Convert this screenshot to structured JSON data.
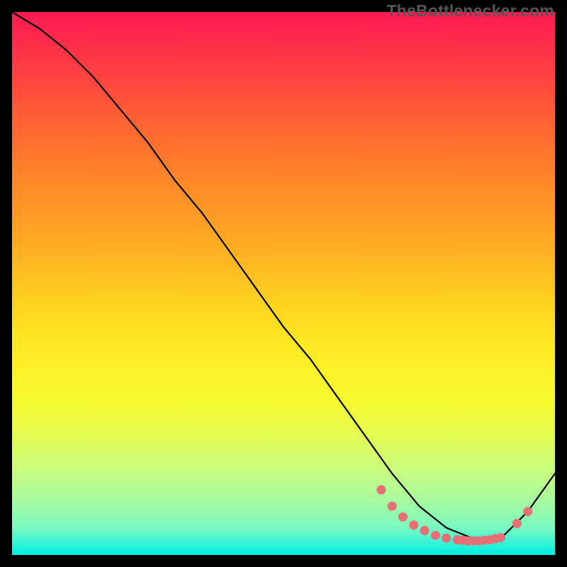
{
  "attribution": "TheBottlenecker.com",
  "chart_data": {
    "type": "line",
    "title": "",
    "xlabel": "",
    "ylabel": "",
    "xlim": [
      0,
      100
    ],
    "ylim": [
      0,
      100
    ],
    "series": [
      {
        "name": "curve",
        "x": [
          0,
          5,
          10,
          15,
          20,
          25,
          30,
          35,
          40,
          45,
          50,
          55,
          60,
          65,
          70,
          75,
          80,
          85,
          90,
          95,
          100
        ],
        "values": [
          100,
          97,
          93,
          88,
          82,
          76,
          69,
          63,
          56,
          49,
          42,
          36,
          29,
          22,
          15,
          9,
          5,
          3,
          3,
          8,
          15
        ]
      }
    ],
    "markers": {
      "name": "highlight-points",
      "color": "#e77077",
      "x": [
        68,
        70,
        72,
        74,
        76,
        78,
        80,
        82,
        83,
        84,
        85,
        86,
        87,
        88,
        89,
        90,
        93,
        95
      ],
      "values": [
        12,
        9,
        7,
        5.5,
        4.5,
        3.6,
        3.1,
        2.8,
        2.7,
        2.6,
        2.6,
        2.6,
        2.7,
        2.8,
        3.0,
        3.2,
        5.8,
        8.0
      ]
    }
  }
}
